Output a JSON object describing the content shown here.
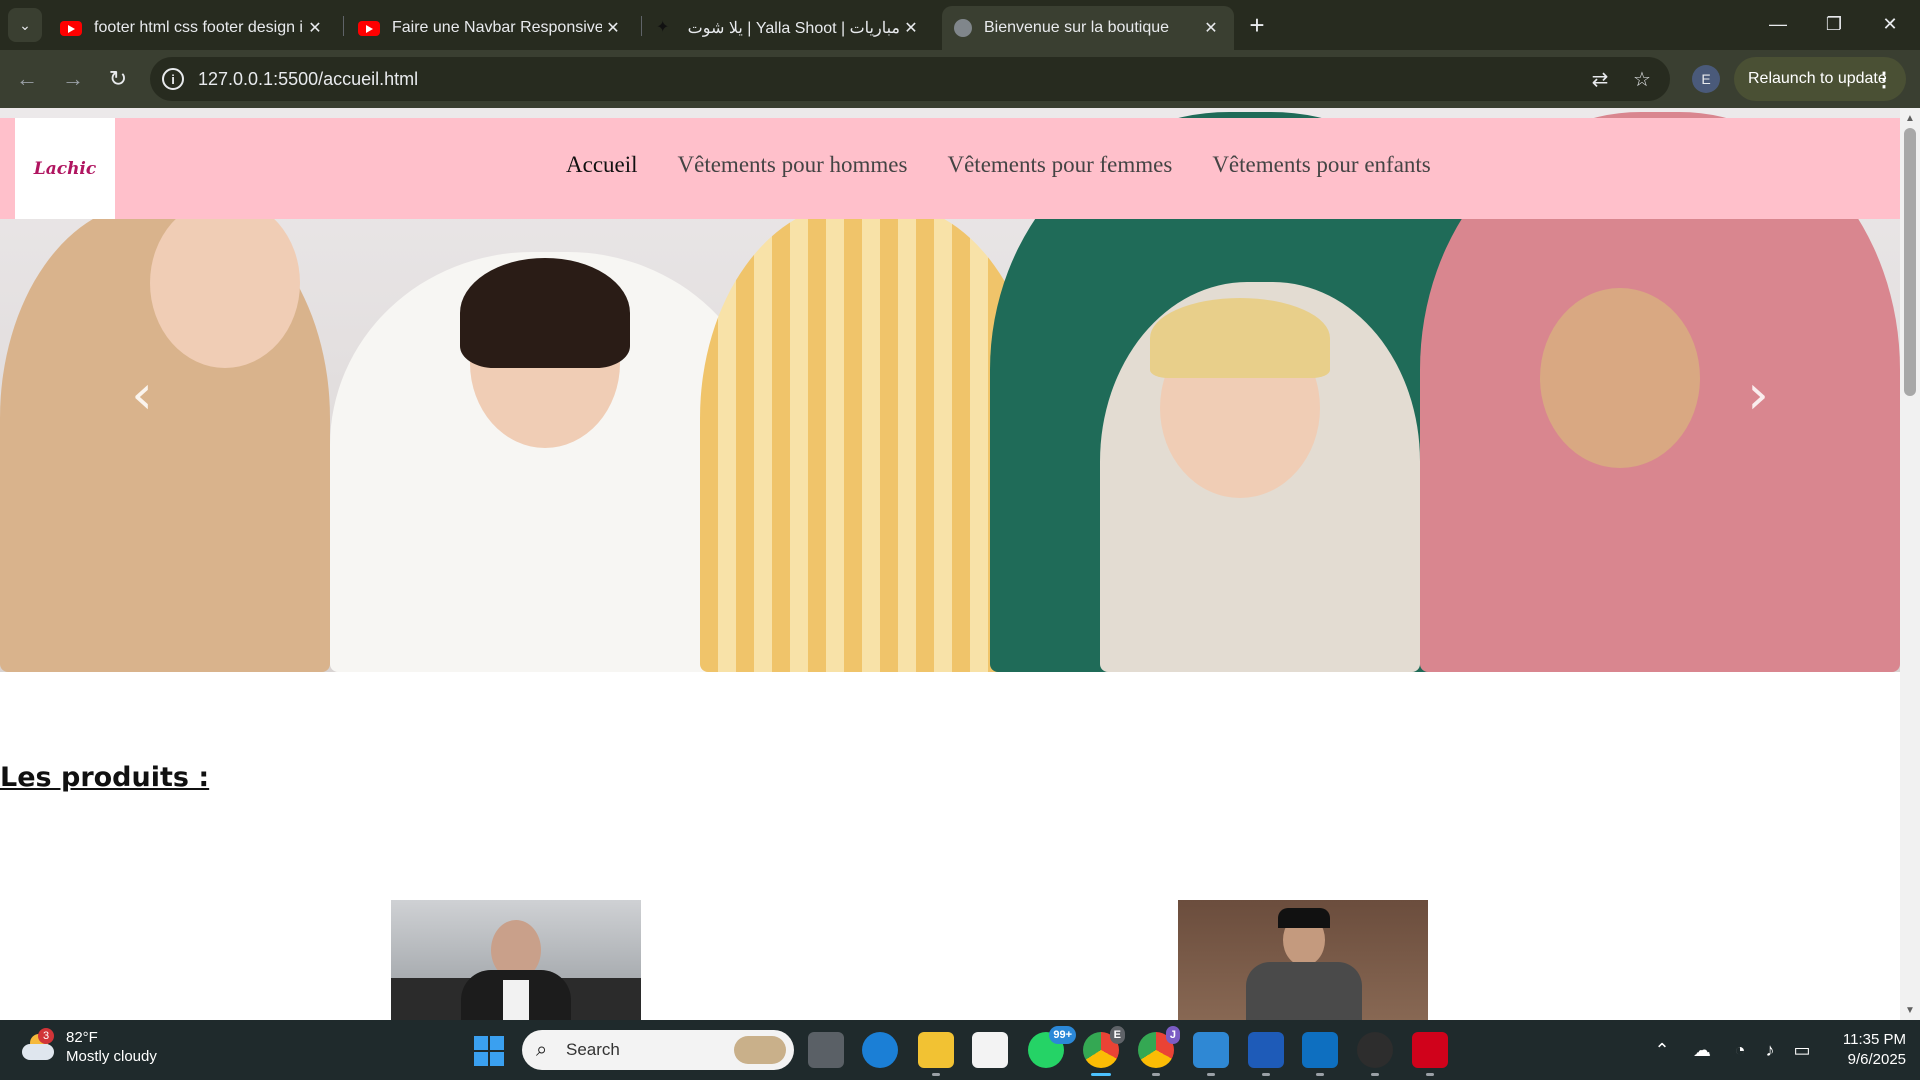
{
  "browser": {
    "tabs": [
      {
        "title": "footer html css footer design in",
        "icon": "youtube-icon"
      },
      {
        "title": "Faire une Navbar Responsive en",
        "icon": "youtube-icon"
      },
      {
        "title": "مباريات | Yalla Shoot | يلا شوت",
        "icon": "yalla-shoot-icon"
      },
      {
        "title": "Bienvenue sur la boutique",
        "icon": "globe-icon",
        "active": true
      }
    ],
    "url": "127.0.0.1:5500/accueil.html",
    "profile_initial": "E",
    "relaunch_label": "Relaunch to update"
  },
  "site": {
    "logo_text": "Lachic",
    "nav": [
      {
        "label": "Accueil",
        "current": true
      },
      {
        "label": "Vêtements pour hommes"
      },
      {
        "label": "Vêtements pour femmes"
      },
      {
        "label": "Vêtements pour enfants"
      }
    ],
    "products_heading": "Les produits :",
    "hero_arrows": {
      "prev": "‹",
      "next": "›"
    }
  },
  "taskbar": {
    "weather": {
      "temp": "82°F",
      "condition": "Mostly cloudy",
      "badge": "3"
    },
    "search_placeholder": "Search",
    "whatsapp_badge": "99+",
    "chrome_profile_badge": "E",
    "chrome2_profile_badge": "J",
    "time": "11:35 PM",
    "date": "9/6/2025"
  },
  "colors": {
    "nav_background": "#ffc0cb",
    "browser_frame": "#272b1f",
    "toolbar": "#3a3f31"
  }
}
